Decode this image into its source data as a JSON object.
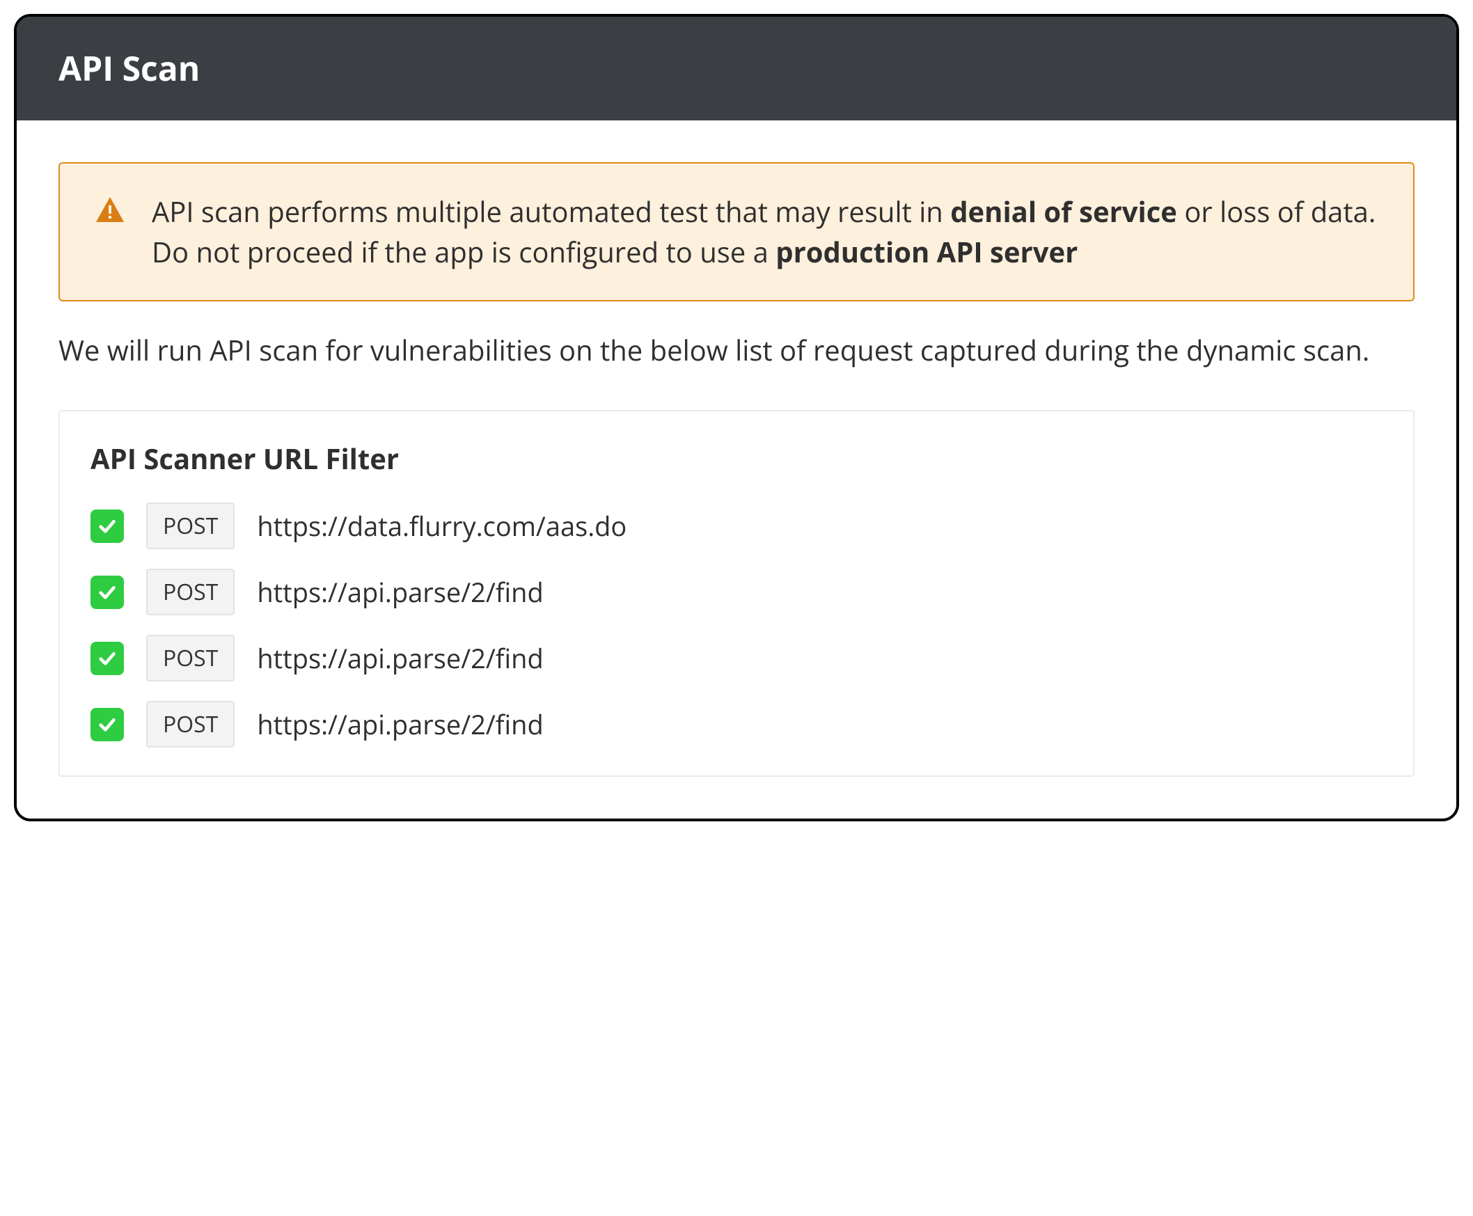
{
  "header": {
    "title": "API Scan"
  },
  "alert": {
    "text_before_bold1": "API scan performs multiple automated test that may result in ",
    "bold1": "denial of service",
    "text_mid": " or loss of data. Do not proceed if the app is configured to use a ",
    "bold2": "production API server"
  },
  "intro": "We will run API scan for vulnerabilities on the below list of request captured during the dynamic scan.",
  "filter": {
    "title": "API Scanner URL Filter",
    "requests": [
      {
        "checked": true,
        "method": "POST",
        "url": "https://data.flurry.com/aas.do"
      },
      {
        "checked": true,
        "method": "POST",
        "url": "https://api.parse/2/find"
      },
      {
        "checked": true,
        "method": "POST",
        "url": "https://api.parse/2/find"
      },
      {
        "checked": true,
        "method": "POST",
        "url": "https://api.parse/2/find"
      }
    ]
  },
  "colors": {
    "header_bg": "#3b3f44",
    "alert_border": "#e08a1e",
    "alert_bg": "#fdf0dc",
    "checkbox_green": "#2ecc40"
  }
}
